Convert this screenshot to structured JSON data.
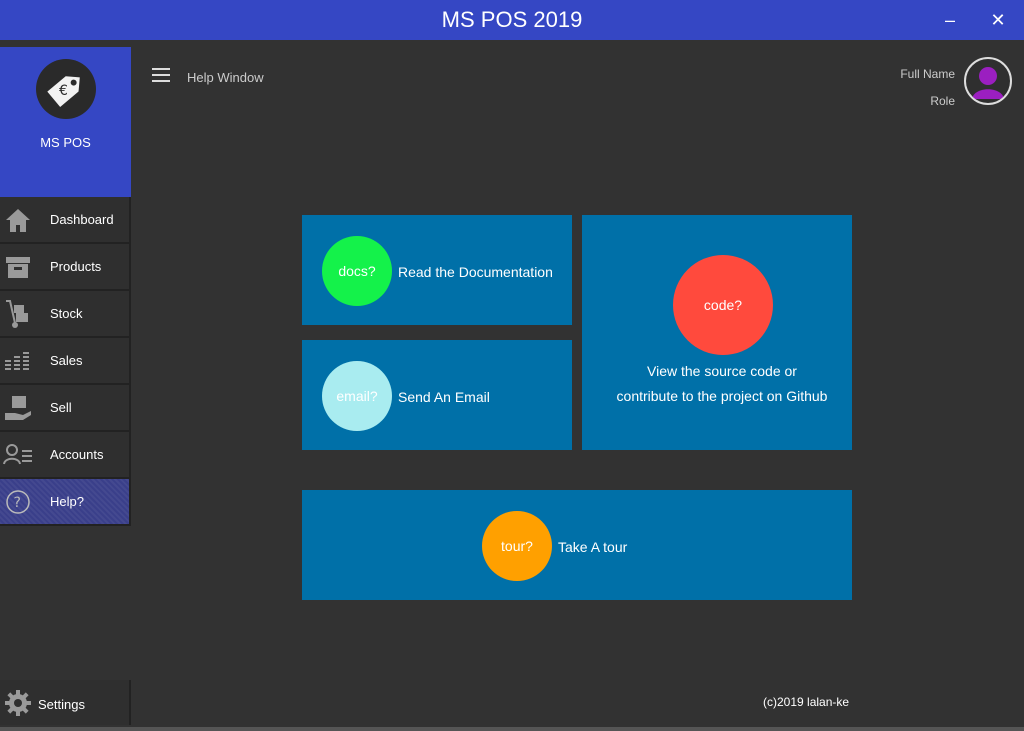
{
  "window": {
    "title": "MS POS 2019",
    "minimize_label": "–",
    "close_label": "✕"
  },
  "brand": {
    "name": "MS POS",
    "logo_symbol": "€"
  },
  "sidebar": {
    "items": [
      {
        "label": "Dashboard",
        "icon": "home-icon"
      },
      {
        "label": "Products",
        "icon": "box-icon"
      },
      {
        "label": "Stock",
        "icon": "hand-truck-icon"
      },
      {
        "label": "Sales",
        "icon": "bars-icon"
      },
      {
        "label": "Sell",
        "icon": "hand-box-icon"
      },
      {
        "label": "Accounts",
        "icon": "user-list-icon"
      },
      {
        "label": "Help?",
        "icon": "question-icon",
        "active": true
      }
    ],
    "settings_label": "Settings"
  },
  "header": {
    "page_title": "Help Window",
    "user_name": "Full Name",
    "user_role": "Role"
  },
  "tiles": {
    "docs": {
      "circle": "docs?",
      "text": "Read the Documentation",
      "color": "#14f24a"
    },
    "email": {
      "circle": "email?",
      "text": "Send An Email",
      "color": "#a9ecf0"
    },
    "code": {
      "circle": "code?",
      "line1": "View the source code or",
      "line2": "contribute to the  project on Github",
      "color": "#ff4a3d"
    },
    "tour": {
      "circle": "tour?",
      "text": "Take A tour",
      "color": "#ffa000"
    }
  },
  "footer": {
    "copyright": "(c)2019 lalan-ke"
  },
  "colors": {
    "accent": "#3547c4",
    "tile": "#0070a8",
    "background": "#323232"
  }
}
